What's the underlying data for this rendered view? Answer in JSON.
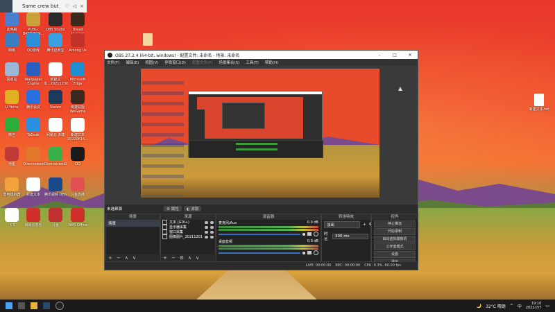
{
  "notification": {
    "title": "Same crew but"
  },
  "desktop_icons": [
    {
      "label": "此电脑",
      "color": "#4a7fd0"
    },
    {
      "label": "PUBG: BATTLEGR...",
      "color": "#c9a23a"
    },
    {
      "label": "OBS Studio",
      "color": "#2a2a2a"
    },
    {
      "label": "Dread Hunger",
      "color": "#3b2a1a"
    },
    {
      "label": "网络",
      "color": "#3a7fc4"
    },
    {
      "label": "QQ游戏",
      "color": "#2a8fd8"
    },
    {
      "label": "腾讯应用宝",
      "color": "#3aa0e0"
    },
    {
      "label": "Among Us",
      "color": "#c2302a"
    },
    {
      "label": "回收站",
      "color": "#9bb8d8"
    },
    {
      "label": "Wallpaper Engine",
      "color": "#2a5fbf"
    },
    {
      "label": "新建文本...20211230",
      "color": "#ffffff"
    },
    {
      "label": "Microsoft Edge",
      "color": "#1f8fd0"
    },
    {
      "label": "Li Yinhe",
      "color": "#e0b020"
    },
    {
      "label": "腾讯会议",
      "color": "#2a6fe0"
    },
    {
      "label": "Steam",
      "color": "#1b3a5c"
    },
    {
      "label": "英雄联盟 WeGame",
      "color": "#3a2a1f"
    },
    {
      "label": "微信",
      "color": "#2aae3a"
    },
    {
      "label": "ToDesk",
      "color": "#2a8fe0"
    },
    {
      "label": "网易云 多端",
      "color": "#ffffff"
    },
    {
      "label": "新建文本 20220615...",
      "color": "#ffffff"
    },
    {
      "label": "地图",
      "color": "#c03a3a"
    },
    {
      "label": "Overcooked",
      "color": "#e07a2a"
    },
    {
      "label": "Overcooked2",
      "color": "#3ab04a"
    },
    {
      "label": "QQ",
      "color": "#1a1a1a"
    },
    {
      "label": "雷电模拟器",
      "color": "#f2a23a"
    },
    {
      "label": "新建文本",
      "color": "#ffffff"
    },
    {
      "label": "腾讯视频 OBS",
      "color": "#1a4a8a"
    },
    {
      "label": "斗鱼直播",
      "color": "#e05050"
    },
    {
      "label": "飞书",
      "color": "#ffffff"
    },
    {
      "label": "网易云音乐",
      "color": "#d0302a"
    },
    {
      "label": "斗鱼",
      "color": "#c03030"
    },
    {
      "label": "WPS Office",
      "color": "#d0302a"
    }
  ],
  "desktop_files": [
    {
      "label": ""
    },
    {
      "label": "新建文本.txt"
    }
  ],
  "obs": {
    "title": "OBS 27.2.4 (64-bit, windows) - 配置文件: 未命名 - 场景: 未命名",
    "menu": [
      "文件(F)",
      "编辑(E)",
      "视图(V)",
      "停靠窗口(D)",
      "配置文件(P)",
      "场景集合(S)",
      "工具(T)",
      "帮助(H)"
    ],
    "scene_label": "未选择源",
    "chips": [
      "属性",
      "滤镜"
    ],
    "docks": {
      "scenes": {
        "title": "场景",
        "items": [
          "场景"
        ]
      },
      "sources": {
        "title": "来源",
        "items": [
          "文本 (GDI+)",
          "显示器采集",
          "窗口采集",
          "图像图片_20211201"
        ]
      },
      "mixer": {
        "title": "混音器",
        "channels": [
          {
            "name": "麦克风/Aux",
            "db": "0.0 dB"
          },
          {
            "name": "桌面音频",
            "db": "0.0 dB"
          }
        ]
      },
      "transitions": {
        "title": "转场特效",
        "effect": "淡出",
        "duration_label": "时长",
        "duration": "300 ms"
      },
      "controls": {
        "title": "控件",
        "buttons": [
          "停止推流",
          "开始录制",
          "启动虚拟摄像机",
          "工作室模式",
          "设置",
          "退出"
        ]
      }
    },
    "status": {
      "live": "LIVE: 00:00:00",
      "rec": "REC: 00:00:00",
      "cpu": "CPU: 0.3%, 60.00 fps"
    }
  },
  "taskbar": {
    "weather": "32°C 晴朗",
    "lang": "中",
    "time": "19:10",
    "date": "2022/7/7"
  }
}
